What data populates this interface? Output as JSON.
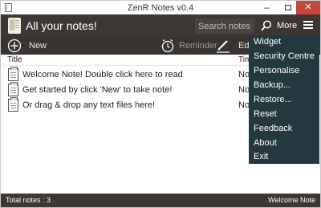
{
  "window": {
    "title": "ZenR Notes v0.4",
    "minimize_glyph": "–",
    "close_glyph": "✕"
  },
  "header": {
    "title": "All your notes!",
    "search_placeholder": "Search notes...",
    "more_label": "More"
  },
  "toolbar": {
    "new_label": "New",
    "reminder_label": "Reminder",
    "edit_label": "Ed"
  },
  "list": {
    "columns": {
      "title": "Title",
      "time": "Tim"
    },
    "rows": [
      {
        "title": "Welcome Note! Double click here to read",
        "time": "No"
      },
      {
        "title": "Get started by click 'New' to take note!",
        "time": "No"
      },
      {
        "title": "Or drag & drop any text files here!",
        "time": "No"
      }
    ]
  },
  "status": {
    "left": "Total notes : 3",
    "right": "Welcome Note"
  },
  "menu": {
    "items": [
      "Widget",
      "Security Centre",
      "Personalise",
      "Backup...",
      "Restore...",
      "Reset",
      "Feedback",
      "About",
      "Exit"
    ]
  },
  "colors": {
    "header_bg": "#3c3634",
    "menu_bg": "#24383f",
    "close_button": "#c7463c"
  },
  "icons": [
    "app-icon",
    "notes-icon",
    "search-icon",
    "hamburger-icon",
    "add-icon",
    "clock-icon",
    "pencil-icon",
    "note-icon"
  ]
}
